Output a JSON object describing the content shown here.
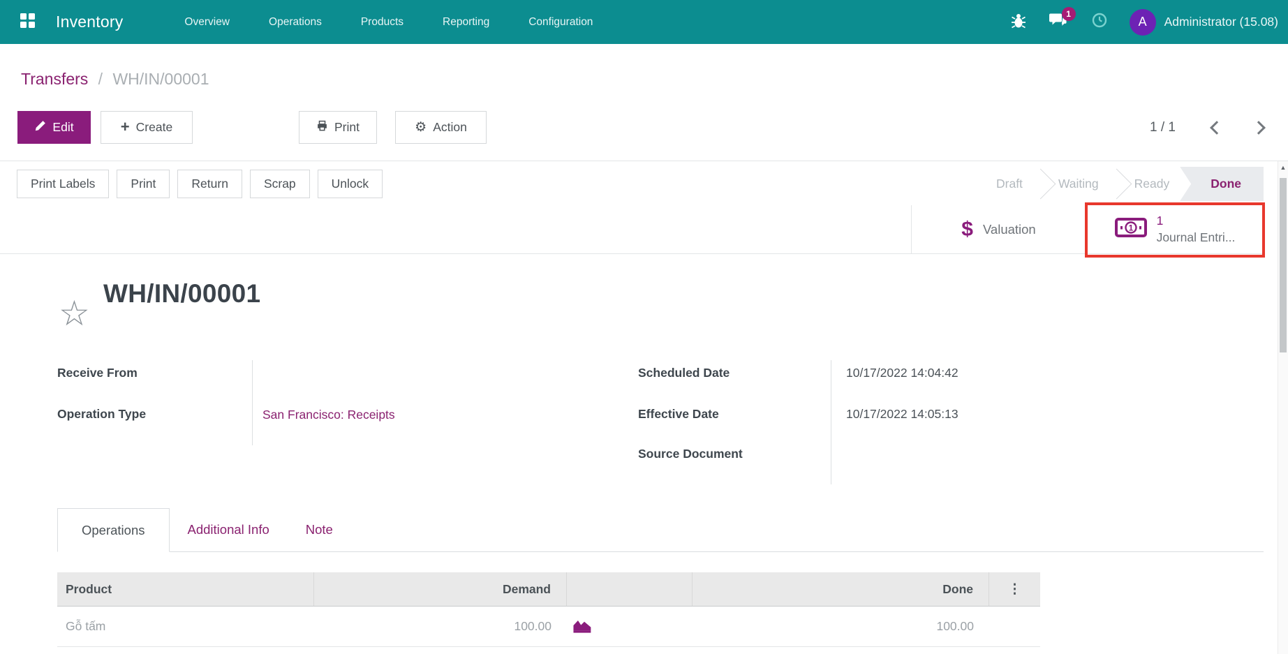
{
  "colors": {
    "navbar_bg": "#0c8d90",
    "accent_purple": "#8a1c7c",
    "link_purple": "#8a2270",
    "highlight_red": "#e8382d",
    "status_done_text": "#8a2270"
  },
  "navbar": {
    "app_name": "Inventory",
    "menus": [
      "Overview",
      "Operations",
      "Products",
      "Reporting",
      "Configuration"
    ],
    "message_badge": "1",
    "user_initial": "A",
    "user_name": "Administrator (15.08)"
  },
  "breadcrumb": {
    "parent": "Transfers",
    "separator": "/",
    "current": "WH/IN/00001"
  },
  "control_panel": {
    "edit": "Edit",
    "create": "Create",
    "print": "Print",
    "action": "Action",
    "pager": "1 / 1"
  },
  "form_buttons": {
    "print_labels": "Print Labels",
    "print": "Print",
    "return": "Return",
    "scrap": "Scrap",
    "unlock": "Unlock"
  },
  "statusbar": {
    "stages": [
      "Draft",
      "Waiting",
      "Ready",
      "Done"
    ],
    "active": "Done"
  },
  "smart_buttons": {
    "valuation_label": "Valuation",
    "journal_count": "1",
    "journal_label": "Journal Entri..."
  },
  "record": {
    "title": "WH/IN/00001",
    "receive_from_label": "Receive From",
    "receive_from_value": "",
    "operation_type_label": "Operation Type",
    "operation_type_value": "San Francisco: Receipts",
    "scheduled_date_label": "Scheduled Date",
    "scheduled_date_value": "10/17/2022 14:04:42",
    "effective_date_label": "Effective Date",
    "effective_date_value": "10/17/2022 14:05:13",
    "source_document_label": "Source Document",
    "source_document_value": ""
  },
  "tabs": [
    "Operations",
    "Additional Info",
    "Note"
  ],
  "table": {
    "headers": {
      "product": "Product",
      "demand": "Demand",
      "done": "Done"
    },
    "rows": [
      {
        "product": "Gỗ tấm",
        "demand": "100.00",
        "done": "100.00"
      }
    ]
  }
}
